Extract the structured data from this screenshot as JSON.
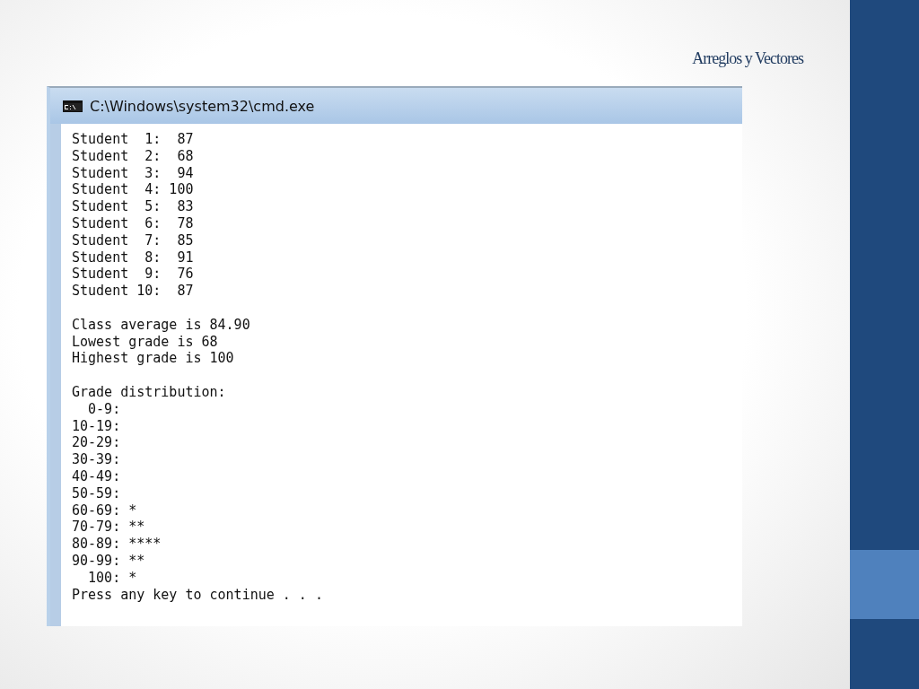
{
  "slide": {
    "title": "Arreglos y Vectores"
  },
  "console": {
    "title": "C:\\Windows\\system32\\cmd.exe",
    "blocks": [
      [
        "Student  1:  87",
        "Student  2:  68",
        "Student  3:  94",
        "Student  4: 100",
        "Student  5:  83",
        "Student  6:  78",
        "Student  7:  85",
        "Student  8:  91",
        "Student  9:  76",
        "Student 10:  87"
      ],
      [
        "Class average is 84.90",
        "Lowest grade is 68",
        "Highest grade is 100"
      ],
      [
        "Grade distribution:",
        "  0-9:",
        "10-19:",
        "20-29:",
        "30-39:",
        "40-49:",
        "50-59:",
        "60-69: *",
        "70-79: **",
        "80-89: ****",
        "90-99: **",
        "  100: *",
        "Press any key to continue . . ."
      ]
    ]
  }
}
